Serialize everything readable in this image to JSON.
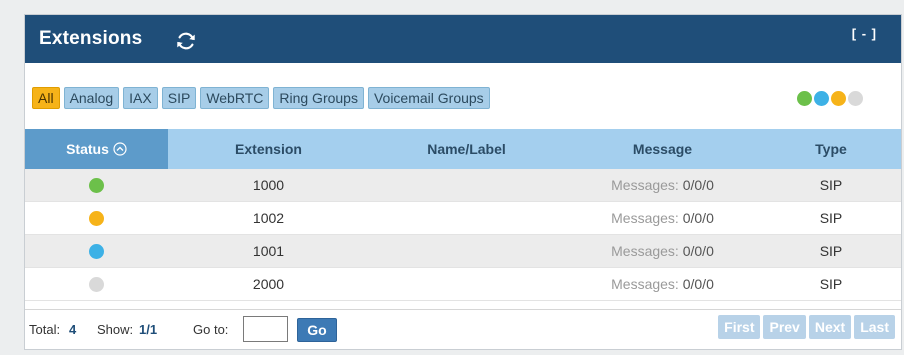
{
  "panel": {
    "title": "Extensions",
    "collapse_label": "[ - ]",
    "refresh_icon": "refresh-icon"
  },
  "filters": [
    "All",
    "Analog",
    "IAX",
    "SIP",
    "WebRTC",
    "Ring Groups",
    "Voicemail Groups"
  ],
  "active_filter": "All",
  "legend_colors": [
    "#6cc04a",
    "#3db1e6",
    "#f6b319",
    "#d9d9d9"
  ],
  "table": {
    "headers": {
      "status": "Status",
      "extension": "Extension",
      "name": "Name/Label",
      "message": "Message",
      "type": "Type"
    },
    "sorted_by": "status",
    "rows": [
      {
        "status_color": "#6cc04a",
        "extension": "1000",
        "name": "",
        "message_label": "Messages:",
        "message_count": "0/0/0",
        "type": "SIP"
      },
      {
        "status_color": "#f6b319",
        "extension": "1002",
        "name": "",
        "message_label": "Messages:",
        "message_count": "0/0/0",
        "type": "SIP"
      },
      {
        "status_color": "#3db1e6",
        "extension": "1001",
        "name": "",
        "message_label": "Messages:",
        "message_count": "0/0/0",
        "type": "SIP"
      },
      {
        "status_color": "#d9d9d9",
        "extension": "2000",
        "name": "",
        "message_label": "Messages:",
        "message_count": "0/0/0",
        "type": "SIP"
      }
    ]
  },
  "footer": {
    "total_label": "Total:",
    "total_value": "4",
    "show_label": "Show:",
    "show_value": "1/1",
    "goto_label": "Go to:",
    "goto_value": "",
    "go_label": "Go",
    "pager": [
      "First",
      "Prev",
      "Next",
      "Last"
    ]
  }
}
